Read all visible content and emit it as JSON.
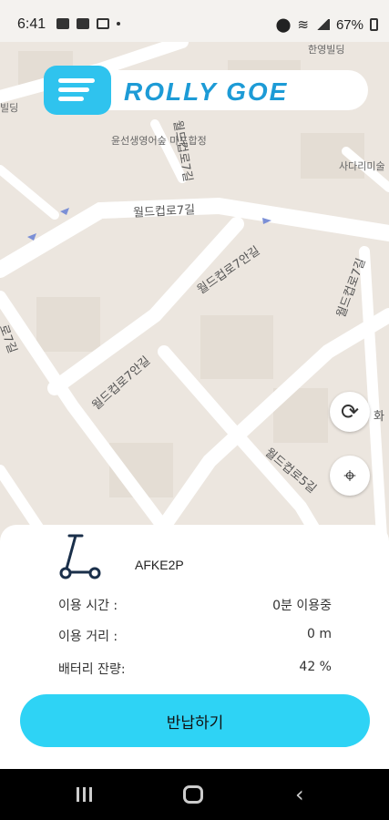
{
  "status_bar": {
    "time": "6:41",
    "battery": "67%",
    "left_icons": [
      "gallery-icon",
      "message-icon",
      "wifi-call-icon",
      "dot-icon"
    ],
    "right_icons": [
      "location-icon",
      "wifi-icon",
      "lte-icon",
      "signal-icon",
      "battery-icon"
    ]
  },
  "header": {
    "logo_text": "ROLLY GOE",
    "menu_icon": "menu-icon",
    "brand_color": "#2fc3ee"
  },
  "map": {
    "labels": [
      {
        "text": "한영빌딩"
      },
      {
        "text": "빌딩"
      },
      {
        "text": "윤선생영어숲 마포합정"
      },
      {
        "text": "사다리미술"
      },
      {
        "text": "월드컵로7길"
      },
      {
        "text": "월드컵로7안길"
      },
      {
        "text": "월드컵로7안길"
      },
      {
        "text": "월드컵로7길"
      },
      {
        "text": "월드컵로5길"
      },
      {
        "text": "월드컵로7길"
      },
      {
        "text": "로7길"
      },
      {
        "text": "화"
      }
    ],
    "refresh_icon": "refresh-icon",
    "locate_icon": "crosshair-icon"
  },
  "panel": {
    "device_id": "AFKE2P",
    "scooter_icon": "scooter-icon",
    "rows": [
      {
        "label": "이용 시간 :",
        "value": "0분 이용중"
      },
      {
        "label": "이용 거리 :",
        "value": "0 m"
      },
      {
        "label": "배터리 잔량:",
        "value": "42 %"
      }
    ],
    "return_button": "반납하기",
    "accent": "#2ed3f5"
  },
  "nav_bar": {
    "icons": [
      "recents-icon",
      "home-icon",
      "back-icon"
    ]
  }
}
